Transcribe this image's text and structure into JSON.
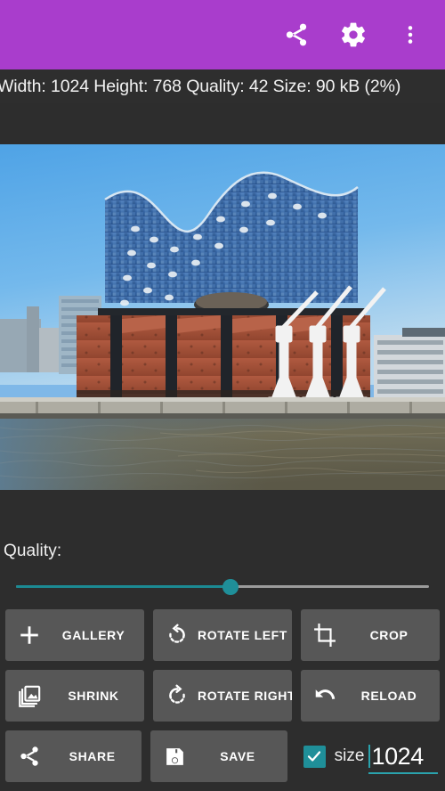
{
  "appbar": {
    "background_color": "#a93dcc",
    "actions": [
      {
        "name": "share-icon",
        "label": "Share"
      },
      {
        "name": "gear-icon",
        "label": "Settings"
      },
      {
        "name": "more-vert-icon",
        "label": "More options"
      }
    ]
  },
  "infobar": {
    "text": "Width: 1024 Height: 768 Quality: 42 Size: 90 kB (2%)",
    "width": "1024",
    "height": "768",
    "quality": "42",
    "size": "90 kB",
    "percent": "2%"
  },
  "photo": {
    "alt": "Elbphilharmonie concert hall on the Hamburg waterfront with three white harbour cranes",
    "sky_color": "#63aee8",
    "glass_color": "#2f5e9e",
    "brick_color": "#a6503a",
    "water_color": "#6d6450"
  },
  "quality_control": {
    "label": "Quality:",
    "value": 42,
    "percent_position": 52,
    "accent_color": "#1f8f99",
    "track_color": "#9b9b9b"
  },
  "buttons": [
    [
      {
        "label": "GALLERY",
        "icon": "plus-icon",
        "name": "gallery-button"
      },
      {
        "label": "ROTATE LEFT",
        "icon": "rotate-left-icon",
        "name": "rotate-left-button"
      },
      {
        "label": "CROP",
        "icon": "crop-icon",
        "name": "crop-button"
      }
    ],
    [
      {
        "label": "SHRINK",
        "icon": "photo-library-icon",
        "name": "shrink-button"
      },
      {
        "label": "ROTATE RIGHT",
        "icon": "rotate-right-icon",
        "name": "rotate-right-button"
      },
      {
        "label": "RELOAD",
        "icon": "undo-icon",
        "name": "reload-button"
      }
    ],
    [
      {
        "label": "SHARE",
        "icon": "share-icon",
        "name": "share-button"
      },
      {
        "label": "SAVE",
        "icon": "save-icon",
        "name": "save-button"
      }
    ]
  ],
  "size_field": {
    "checkbox_checked": true,
    "checkbox_color": "#1f8f99",
    "label": "size",
    "value": "1024",
    "underline_color": "#2aa3ad"
  }
}
